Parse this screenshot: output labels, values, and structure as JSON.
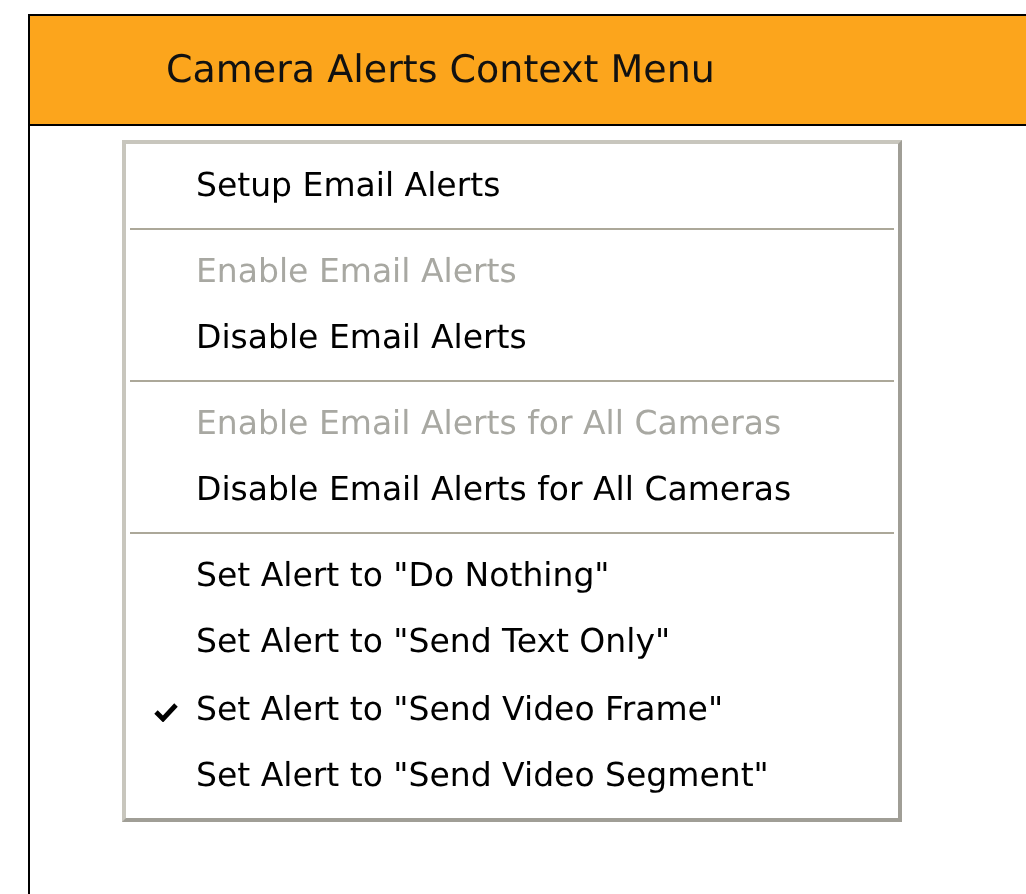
{
  "title": "Camera Alerts Context Menu",
  "menu": {
    "groups": [
      [
        {
          "label": "Setup Email Alerts",
          "disabled": false,
          "checked": false
        }
      ],
      [
        {
          "label": "Enable Email Alerts",
          "disabled": true,
          "checked": false
        },
        {
          "label": "Disable Email Alerts",
          "disabled": false,
          "checked": false
        }
      ],
      [
        {
          "label": "Enable Email Alerts for All Cameras",
          "disabled": true,
          "checked": false
        },
        {
          "label": "Disable Email Alerts for All Cameras",
          "disabled": false,
          "checked": false
        }
      ],
      [
        {
          "label": "Set Alert to \"Do Nothing\"",
          "disabled": false,
          "checked": false
        },
        {
          "label": "Set Alert to \"Send Text Only\"",
          "disabled": false,
          "checked": false
        },
        {
          "label": "Set Alert to \"Send Video Frame\"",
          "disabled": false,
          "checked": true
        },
        {
          "label": "Set Alert to \"Send Video Segment\"",
          "disabled": false,
          "checked": false
        }
      ]
    ]
  }
}
